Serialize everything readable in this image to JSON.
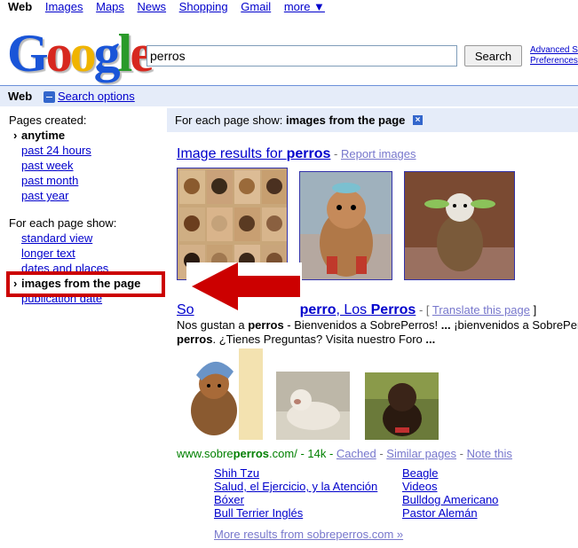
{
  "topnav": {
    "items": [
      "Web",
      "Images",
      "Maps",
      "News",
      "Shopping",
      "Gmail",
      "more ▼"
    ]
  },
  "logo": {
    "text": "Google",
    "tm": "™"
  },
  "search": {
    "value": "perros",
    "button": "Search",
    "advanced": "Advanced S",
    "preferences": "Preferences"
  },
  "bar": {
    "web": "Web",
    "options": "Search options"
  },
  "left": {
    "pages_created": "Pages created:",
    "anytime": "anytime",
    "past24": "past 24 hours",
    "pastweek": "past week",
    "pastmonth": "past month",
    "pastyear": "past year",
    "show_label": "For each page show:",
    "standard": "standard view",
    "longer": "longer text",
    "dates": "dates and places",
    "images": "images from the page",
    "pubdate": "publication date"
  },
  "showbar": {
    "prefix": "For each page show: ",
    "value": "images from the page",
    "close": "×"
  },
  "image_results": {
    "prefix": "Image results for ",
    "query": "perros",
    "sep": " - ",
    "report": "Report images"
  },
  "result": {
    "title_a": "So",
    "title_b": "perro",
    "title_c": ", Los ",
    "title_d": "Perros",
    "dash": " - [ ",
    "translate": "Translate this page",
    "close_bracket": " ]",
    "snip1_a": "Nos gustan a ",
    "snip1_b": "perros",
    "snip1_c": " - Bienvenidos a SobrePerros! ",
    "snip1_d": "...",
    "snip1_e": " ¡bienvenidos a SobrePer",
    "snip2_a": "perros",
    "snip2_b": ". ¿Tienes Preguntas? Visita nuestro Foro ",
    "snip2_c": "...",
    "url_a": "www.sobre",
    "url_b": "perros",
    "url_c": ".com/ - 14k - ",
    "cached": "Cached",
    "dash2": " - ",
    "similar": "Similar pages",
    "dash3": " - ",
    "note": "Note this"
  },
  "sitelinks": {
    "col1": [
      "Shih Tzu",
      "Salud, el Ejercicio, y la Atención",
      "Bóxer",
      "Bull Terrier Inglés"
    ],
    "col2": [
      "Beagle",
      "Videos",
      "Bulldog Americano",
      "Pastor Alemán"
    ],
    "more": "More results from sobreperros.com »"
  },
  "colors": {
    "link": "#0000cc",
    "bar": "#e5ecf9",
    "red": "#cc0000",
    "green": "#008000"
  }
}
